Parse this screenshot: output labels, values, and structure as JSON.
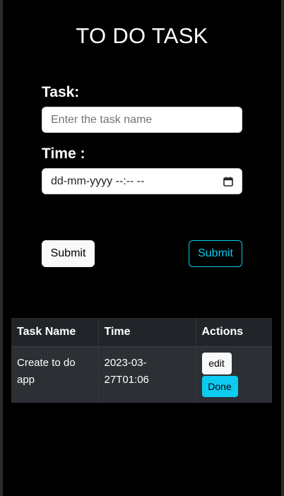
{
  "page": {
    "title": "TO DO TASK"
  },
  "form": {
    "task_label": "Task:",
    "task_placeholder": "Enter the task name",
    "time_label": "Time :",
    "time_value": "dd-mm-yyyy --:-- --",
    "time_icon": "calendar-icon"
  },
  "buttons": {
    "submit_light": "Submit",
    "submit_outline": "Submit"
  },
  "table": {
    "headers": [
      "Task Name",
      "Time",
      "Actions"
    ],
    "rows": [
      {
        "task_name": "Create to do app",
        "time": "2023-03-27T01:06",
        "edit_label": "edit",
        "done_label": "Done"
      }
    ]
  },
  "colors": {
    "background": "#000000",
    "accent": "#0dcaf0",
    "table_header": "#212529",
    "table_row": "#2c3034",
    "light_button": "#f8f9fa"
  }
}
